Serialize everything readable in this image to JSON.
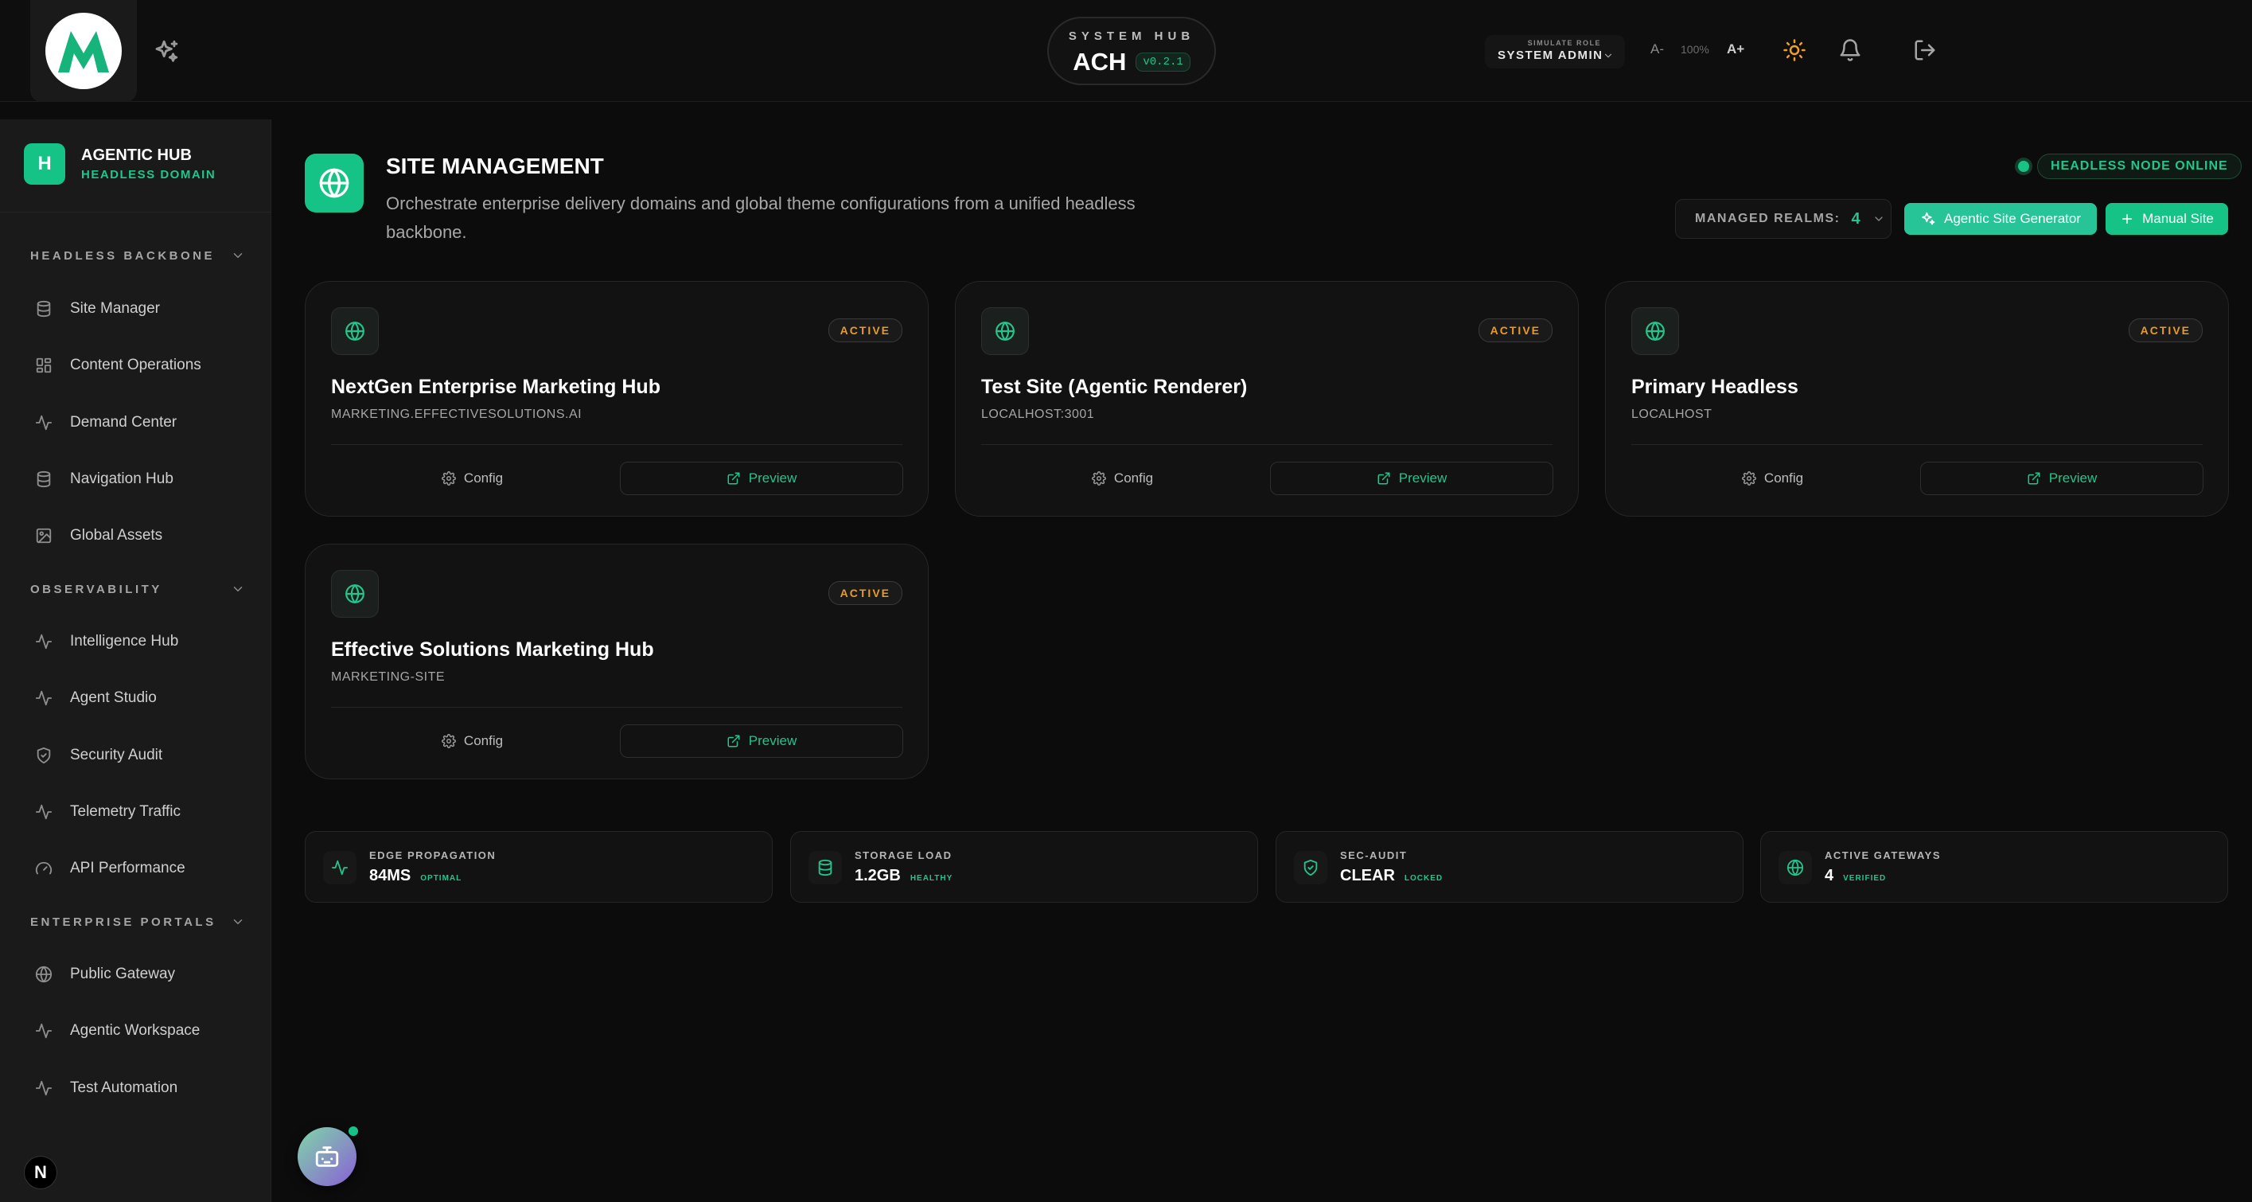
{
  "header": {
    "system_label": "SYSTEM HUB",
    "app_short": "ACH",
    "version": "v0.2.1",
    "role_caption": "SIMULATE ROLE",
    "role_value": "SYSTEM ADMIN",
    "font_decrease": "A-",
    "font_zoom": "100%",
    "font_increase": "A+"
  },
  "sidebar": {
    "brand_initial": "H",
    "brand_title": "AGENTIC HUB",
    "brand_subtitle": "HEADLESS DOMAIN",
    "sections": [
      {
        "label": "HEADLESS BACKBONE",
        "items": [
          "Site Manager",
          "Content Operations",
          "Demand Center",
          "Navigation Hub",
          "Global Assets"
        ]
      },
      {
        "label": "OBSERVABILITY",
        "items": [
          "Intelligence Hub",
          "Agent Studio",
          "Security Audit",
          "Telemetry Traffic",
          "API Performance"
        ]
      },
      {
        "label": "ENTERPRISE PORTALS",
        "items": [
          "Public Gateway",
          "Agentic Workspace",
          "Test Automation"
        ]
      }
    ],
    "footer_badge": "N"
  },
  "main": {
    "title": "SITE MANAGEMENT",
    "description": "Orchestrate enterprise delivery domains and global theme configurations from a unified headless backbone.",
    "node_status": "HEADLESS NODE ONLINE",
    "realms_label": "MANAGED REALMS:",
    "realms_count": "4",
    "generator_button": "Agentic Site Generator",
    "manual_button": "Manual Site"
  },
  "sites": [
    {
      "name": "NextGen Enterprise Marketing Hub",
      "domain": "MARKETING.EFFECTIVESOLUTIONS.AI",
      "status": "ACTIVE",
      "config": "Config",
      "preview": "Preview"
    },
    {
      "name": "Test Site (Agentic Renderer)",
      "domain": "LOCALHOST:3001",
      "status": "ACTIVE",
      "config": "Config",
      "preview": "Preview"
    },
    {
      "name": "Primary Headless",
      "domain": "LOCALHOST",
      "status": "ACTIVE",
      "config": "Config",
      "preview": "Preview"
    },
    {
      "name": "Effective Solutions Marketing Hub",
      "domain": "MARKETING-SITE",
      "status": "ACTIVE",
      "config": "Config",
      "preview": "Preview"
    }
  ],
  "stats": [
    {
      "label": "EDGE PROPAGATION",
      "value": "84MS",
      "tag": "OPTIMAL",
      "icon": "activity-icon"
    },
    {
      "label": "STORAGE LOAD",
      "value": "1.2GB",
      "tag": "HEALTHY",
      "icon": "database-icon"
    },
    {
      "label": "SEC-AUDIT",
      "value": "CLEAR",
      "tag": "LOCKED",
      "icon": "shield-check-icon"
    },
    {
      "label": "ACTIVE GATEWAYS",
      "value": "4",
      "tag": "VERIFIED",
      "icon": "globe-icon"
    }
  ],
  "colors": {
    "accent": "#16c386",
    "accent_text": "#22c58b",
    "status_active": "#e89b2a",
    "background": "#0c0c0c",
    "sidebar": "#1a1a1a"
  }
}
